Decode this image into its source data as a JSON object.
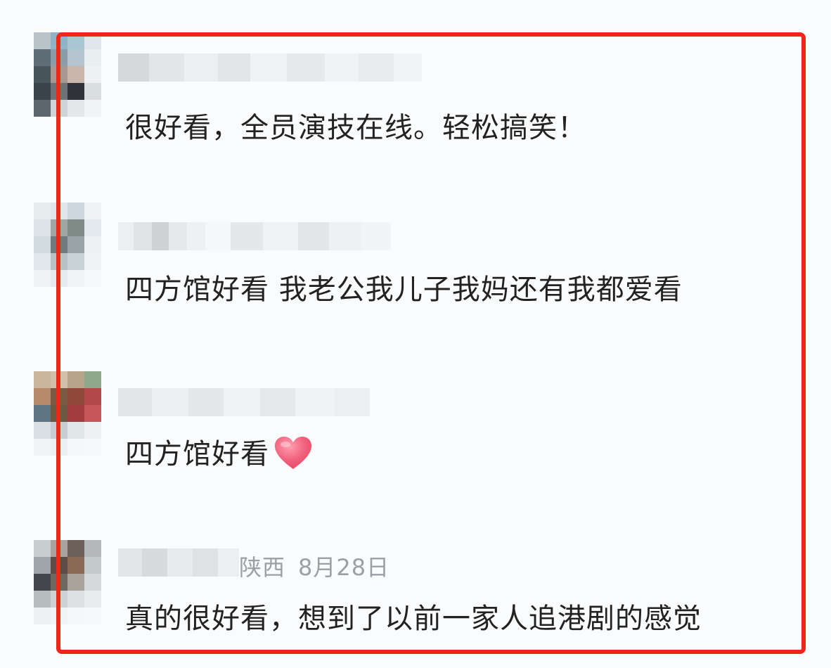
{
  "comments": [
    {
      "text": "很好看，全员演技在线。轻松搞笑！",
      "location": "",
      "date": "",
      "emoji": ""
    },
    {
      "text": "四方馆好看 我老公我儿子我妈还有我都爱看",
      "location": "",
      "date": "",
      "emoji": ""
    },
    {
      "text": "四方馆好看",
      "location": "",
      "date": "",
      "emoji": "heart-icon"
    },
    {
      "text": "真的很好看，想到了以前一家人追港剧的感觉",
      "location": "陕西",
      "date": "8月28日",
      "emoji": ""
    }
  ],
  "colors": {
    "highlight_border": "#f0261b",
    "text": "#222222",
    "meta": "#9aa0a6",
    "heart": "#f0637e"
  }
}
